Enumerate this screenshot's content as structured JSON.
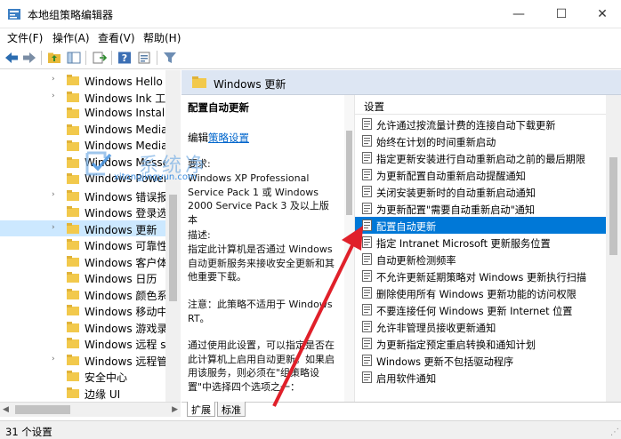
{
  "window": {
    "title": "本地组策略编辑器",
    "controls": {
      "minimize": "—",
      "maximize": "☐",
      "close": "✕"
    }
  },
  "menu": [
    "文件(F)",
    "操作(A)",
    "查看(V)",
    "帮助(H)"
  ],
  "tree": {
    "items": [
      {
        "label": "Windows Hello 企",
        "expandable": true
      },
      {
        "label": "Windows Ink 工作",
        "expandable": true
      },
      {
        "label": "Windows Installer",
        "expandable": false
      },
      {
        "label": "Windows Media",
        "expandable": false
      },
      {
        "label": "Windows Media",
        "expandable": false
      },
      {
        "label": "Windows Messe",
        "expandable": false
      },
      {
        "label": "Windows Power",
        "expandable": false
      },
      {
        "label": "Windows 错误报告",
        "expandable": true
      },
      {
        "label": "Windows 登录选项",
        "expandable": false
      },
      {
        "label": "Windows 更新",
        "expandable": true,
        "selected": true
      },
      {
        "label": "Windows 可靠性",
        "expandable": false
      },
      {
        "label": "Windows 客户体验",
        "expandable": false
      },
      {
        "label": "Windows 日历",
        "expandable": false
      },
      {
        "label": "Windows 颜色系统",
        "expandable": false
      },
      {
        "label": "Windows 移动中心",
        "expandable": false
      },
      {
        "label": "Windows 游戏录制",
        "expandable": false
      },
      {
        "label": "Windows 远程 sh",
        "expandable": false
      },
      {
        "label": "Windows 远程管理",
        "expandable": true
      },
      {
        "label": "安全中心",
        "expandable": false
      },
      {
        "label": "边缘 UI",
        "expandable": false
      }
    ]
  },
  "header": {
    "title": "Windows 更新"
  },
  "description": {
    "title": "配置自动更新",
    "edit_prefix": "编辑",
    "edit_link": "策略设置",
    "requirements_label": "要求:",
    "requirements": "Windows XP Professional Service Pack 1 或 Windows 2000 Service Pack 3 及以上版本",
    "desc_label": "描述:",
    "desc_text": "指定此计算机是否通过 Windows 自动更新服务来接收安全更新和其他重要下载。",
    "note": "注意：此策略不适用于 Windows RT。",
    "usage": "通过使用此设置，可以指定是否在此计算机上启用自动更新。如果启用该服务，则必须在\"组策略设置\"中选择四个选项之一："
  },
  "list": {
    "column_header": "设置",
    "items": [
      "允许通过按流量计费的连接自动下载更新",
      "始终在计划的时间重新启动",
      "指定更新安装进行自动重新启动之前的最后期限",
      "为更新配置自动重新启动提醒通知",
      "关闭安装更新时的自动重新启动通知",
      "为更新配置\"需要自动重新启动\"通知",
      "配置自动更新",
      "指定 Intranet Microsoft 更新服务位置",
      "自动更新检测频率",
      "不允许更新延期策略对 Windows 更新执行扫描",
      "删除使用所有 Windows 更新功能的访问权限",
      "不要连接任何 Windows 更新 Internet 位置",
      "允许非管理员接收更新通知",
      "为更新指定预定重启转换和通知计划",
      "Windows 更新不包括驱动程序",
      "启用软件通知"
    ],
    "selected_index": 6
  },
  "tabs": [
    "扩展",
    "标准"
  ],
  "status": {
    "text": "31 个设置"
  },
  "watermark": {
    "big": "系统净",
    "small": "xitongjingyun.com"
  },
  "colors": {
    "selection": "#0078d7",
    "tree_selection": "#cce8ff",
    "header_bg": "#dde6f3",
    "link": "#0066cc",
    "folder": "#f2c94c",
    "arrow": "#e0202a"
  }
}
